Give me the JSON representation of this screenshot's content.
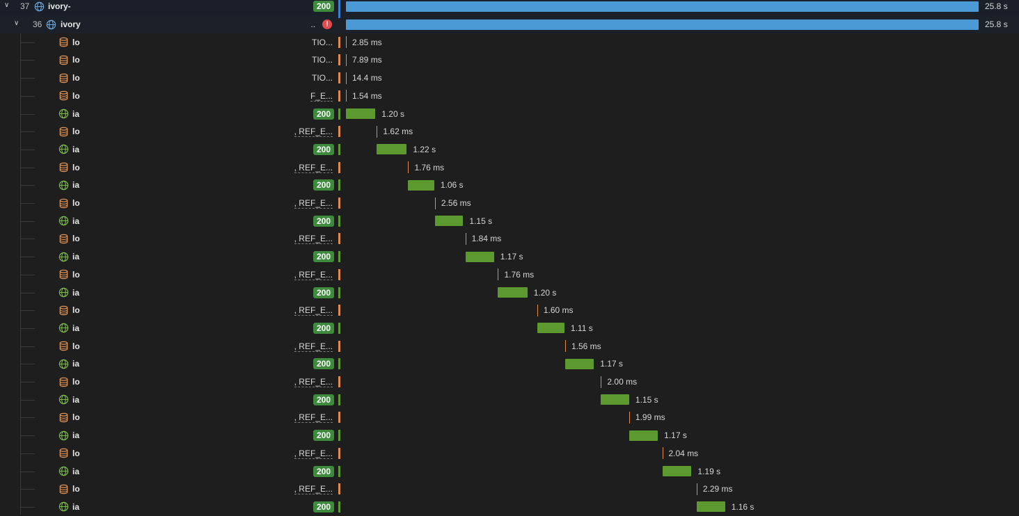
{
  "colors": {
    "http_bar": "#4b9ad6",
    "ok_bar": "#5c9a2f",
    "db_tick": "#e08a4f",
    "badge_ok": "#3e8b3e",
    "error": "#e5484d",
    "http_icon": "#6fa8dc",
    "ok_icon": "#7cbf4a",
    "db_icon": "#e0955a"
  },
  "timeline_max_s": 25.8,
  "rows": [
    {
      "id": "r0",
      "kind": "parent",
      "depth": 0,
      "index": "37",
      "expanded": false,
      "icon": "globe-icon",
      "name": "ivory-",
      "trunc": "",
      "status": "200",
      "status_kind": "ok",
      "start_s": 0,
      "dur_s": 25.8,
      "dur_label": "25.8 s"
    },
    {
      "id": "r1",
      "kind": "parent",
      "depth": 1,
      "index": "36",
      "expanded": true,
      "icon": "globe-icon",
      "name": "ivory",
      "trunc": "..",
      "status": "!",
      "status_kind": "error",
      "start_s": 0,
      "dur_s": 25.8,
      "dur_label": "25.8 s"
    },
    {
      "id": "r2",
      "kind": "db",
      "icon": "database-icon",
      "name": "lo",
      "trunc": "TIO...",
      "start_s": 0.0,
      "dur_label": "2.85 ms"
    },
    {
      "id": "r3",
      "kind": "db",
      "icon": "database-icon",
      "name": "lo",
      "trunc": "TIO...",
      "start_s": 0.0,
      "dur_label": "7.89 ms"
    },
    {
      "id": "r4",
      "kind": "db",
      "icon": "database-icon",
      "name": "lo",
      "trunc": "TIO...",
      "start_s": 0.0,
      "dur_label": "14.4 ms"
    },
    {
      "id": "r5",
      "kind": "db",
      "icon": "database-icon",
      "name": "lo",
      "trunc": "F_E...",
      "start_s": 0.0,
      "dur_label": "1.54 ms"
    },
    {
      "id": "r6",
      "kind": "http",
      "icon": "globe-icon",
      "name": "ia",
      "status": "200",
      "start_s": 0.0,
      "dur_s": 1.2,
      "dur_label": "1.20 s"
    },
    {
      "id": "r7",
      "kind": "db",
      "icon": "database-icon",
      "name": "lo",
      "trunc": ", REF_E...",
      "start_s": 1.26,
      "dur_label": "1.62 ms"
    },
    {
      "id": "r8",
      "kind": "http",
      "icon": "globe-icon",
      "name": "ia",
      "status": "200",
      "start_s": 1.26,
      "dur_s": 1.22,
      "dur_label": "1.22 s"
    },
    {
      "id": "r9",
      "kind": "db",
      "icon": "database-icon",
      "name": "lo",
      "trunc": ", REF_E...",
      "start_s": 2.54,
      "dur_label": "1.76 ms"
    },
    {
      "id": "r10",
      "kind": "http",
      "icon": "globe-icon",
      "name": "ia",
      "status": "200",
      "start_s": 2.54,
      "dur_s": 1.06,
      "dur_label": "1.06 s"
    },
    {
      "id": "r11",
      "kind": "db",
      "icon": "database-icon",
      "name": "lo",
      "trunc": ", REF_E...",
      "start_s": 3.63,
      "dur_label": "2.56 ms"
    },
    {
      "id": "r12",
      "kind": "http",
      "icon": "globe-icon",
      "name": "ia",
      "status": "200",
      "start_s": 3.63,
      "dur_s": 1.15,
      "dur_label": "1.15 s"
    },
    {
      "id": "r13",
      "kind": "db",
      "icon": "database-icon",
      "name": "lo",
      "trunc": ", REF_E...",
      "start_s": 4.87,
      "dur_label": "1.84 ms"
    },
    {
      "id": "r14",
      "kind": "http",
      "icon": "globe-icon",
      "name": "ia",
      "status": "200",
      "start_s": 4.87,
      "dur_s": 1.17,
      "dur_label": "1.17 s"
    },
    {
      "id": "r15",
      "kind": "db",
      "icon": "database-icon",
      "name": "lo",
      "trunc": ", REF_E...",
      "start_s": 6.2,
      "dur_label": "1.76 ms"
    },
    {
      "id": "r16",
      "kind": "http",
      "icon": "globe-icon",
      "name": "ia",
      "status": "200",
      "start_s": 6.2,
      "dur_s": 1.2,
      "dur_label": "1.20 s"
    },
    {
      "id": "r17",
      "kind": "db",
      "icon": "database-icon",
      "name": "lo",
      "trunc": ", REF_E...",
      "start_s": 7.8,
      "dur_label": "1.60 ms"
    },
    {
      "id": "r18",
      "kind": "http",
      "icon": "globe-icon",
      "name": "ia",
      "status": "200",
      "start_s": 7.8,
      "dur_s": 1.11,
      "dur_label": "1.11 s"
    },
    {
      "id": "r19",
      "kind": "db",
      "icon": "database-icon",
      "name": "lo",
      "trunc": ", REF_E...",
      "start_s": 8.94,
      "dur_label": "1.56 ms"
    },
    {
      "id": "r20",
      "kind": "http",
      "icon": "globe-icon",
      "name": "ia",
      "status": "200",
      "start_s": 8.94,
      "dur_s": 1.17,
      "dur_label": "1.17 s"
    },
    {
      "id": "r21",
      "kind": "db",
      "icon": "database-icon",
      "name": "lo",
      "trunc": ", REF_E...",
      "start_s": 10.4,
      "dur_label": "2.00 ms"
    },
    {
      "id": "r22",
      "kind": "http",
      "icon": "globe-icon",
      "name": "ia",
      "status": "200",
      "start_s": 10.4,
      "dur_s": 1.15,
      "dur_label": "1.15 s"
    },
    {
      "id": "r23",
      "kind": "db",
      "icon": "database-icon",
      "name": "lo",
      "trunc": ", REF_E...",
      "start_s": 11.55,
      "dur_label": "1.99 ms"
    },
    {
      "id": "r24",
      "kind": "http",
      "icon": "globe-icon",
      "name": "ia",
      "status": "200",
      "start_s": 11.55,
      "dur_s": 1.17,
      "dur_label": "1.17 s"
    },
    {
      "id": "r25",
      "kind": "db",
      "icon": "database-icon",
      "name": "lo",
      "trunc": ", REF_E...",
      "start_s": 12.9,
      "dur_label": "2.04 ms"
    },
    {
      "id": "r26",
      "kind": "http",
      "icon": "globe-icon",
      "name": "ia",
      "status": "200",
      "start_s": 12.9,
      "dur_s": 1.19,
      "dur_label": "1.19 s"
    },
    {
      "id": "r27",
      "kind": "db",
      "icon": "database-icon",
      "name": "lo",
      "trunc": ", REF_E...",
      "start_s": 14.3,
      "dur_label": "2.29 ms"
    },
    {
      "id": "r28",
      "kind": "http",
      "icon": "globe-icon",
      "name": "ia",
      "status": "200",
      "start_s": 14.3,
      "dur_s": 1.16,
      "dur_label": "1.16 s"
    }
  ]
}
